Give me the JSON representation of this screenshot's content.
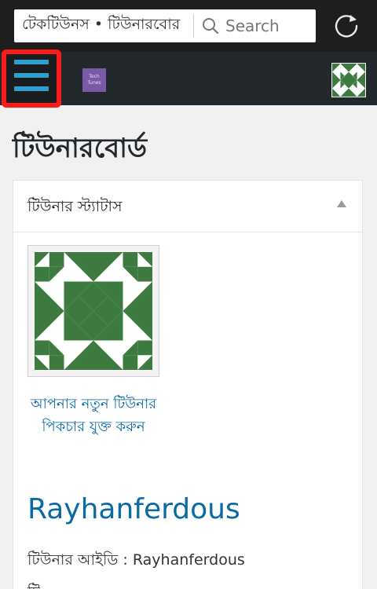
{
  "browser": {
    "url_text": "টেকটিউনস • টিউনারবোর",
    "search_label": "Search"
  },
  "admin_bar": {
    "site_icon_text": "Tech Tunes"
  },
  "page": {
    "title": "টিউনারবোর্ড"
  },
  "status_panel": {
    "title": "টিউনার স্ট্যাটাস",
    "change_picture_link": "আপনার নতুন টিউনার পিকচার যুক্ত করুন",
    "username": "Rayhanferdous",
    "tuner_id_label": "টিউনার আইডি : ",
    "tuner_id_value": "Rayhanferdous",
    "next_row_text": "টি"
  },
  "colors": {
    "admin_bar": "#23282d",
    "menu_icon": "#2ea2cc",
    "highlight_box": "#ff1a1a",
    "link": "#0a6aa1",
    "avatar_green": "#3d7a3f"
  }
}
